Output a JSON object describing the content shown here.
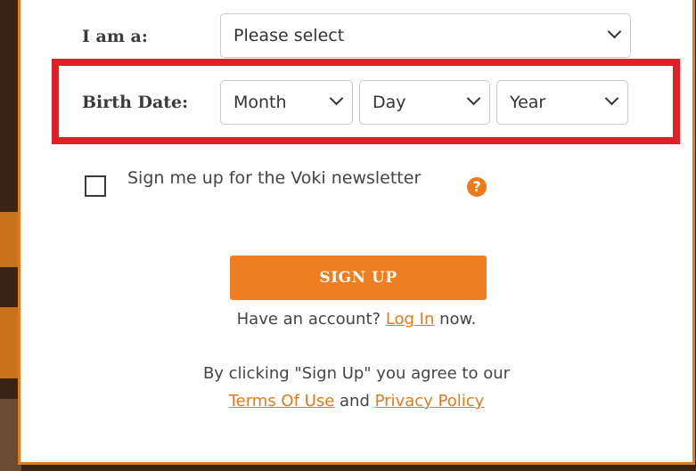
{
  "form": {
    "iam_label": "I am a:",
    "iam_value": "Please select",
    "birth_label": "Birth Date:",
    "month_value": "Month",
    "day_value": "Day",
    "year_value": "Year",
    "newsletter_label": "Sign me up for the Voki newsletter",
    "newsletter_checked": false,
    "help_glyph": "?",
    "signup_label": "SIGN UP"
  },
  "account": {
    "prefix": "Have an account? ",
    "login_link": "Log In",
    "suffix": " now."
  },
  "legal": {
    "line1": "By clicking \"Sign Up\" you agree to our",
    "terms_link": "Terms Of Use",
    "and_text": " and ",
    "privacy_link": "Privacy Policy"
  },
  "colors": {
    "accent": "#ef7e22",
    "highlight": "#e21e26",
    "link": "#e07b1c"
  }
}
